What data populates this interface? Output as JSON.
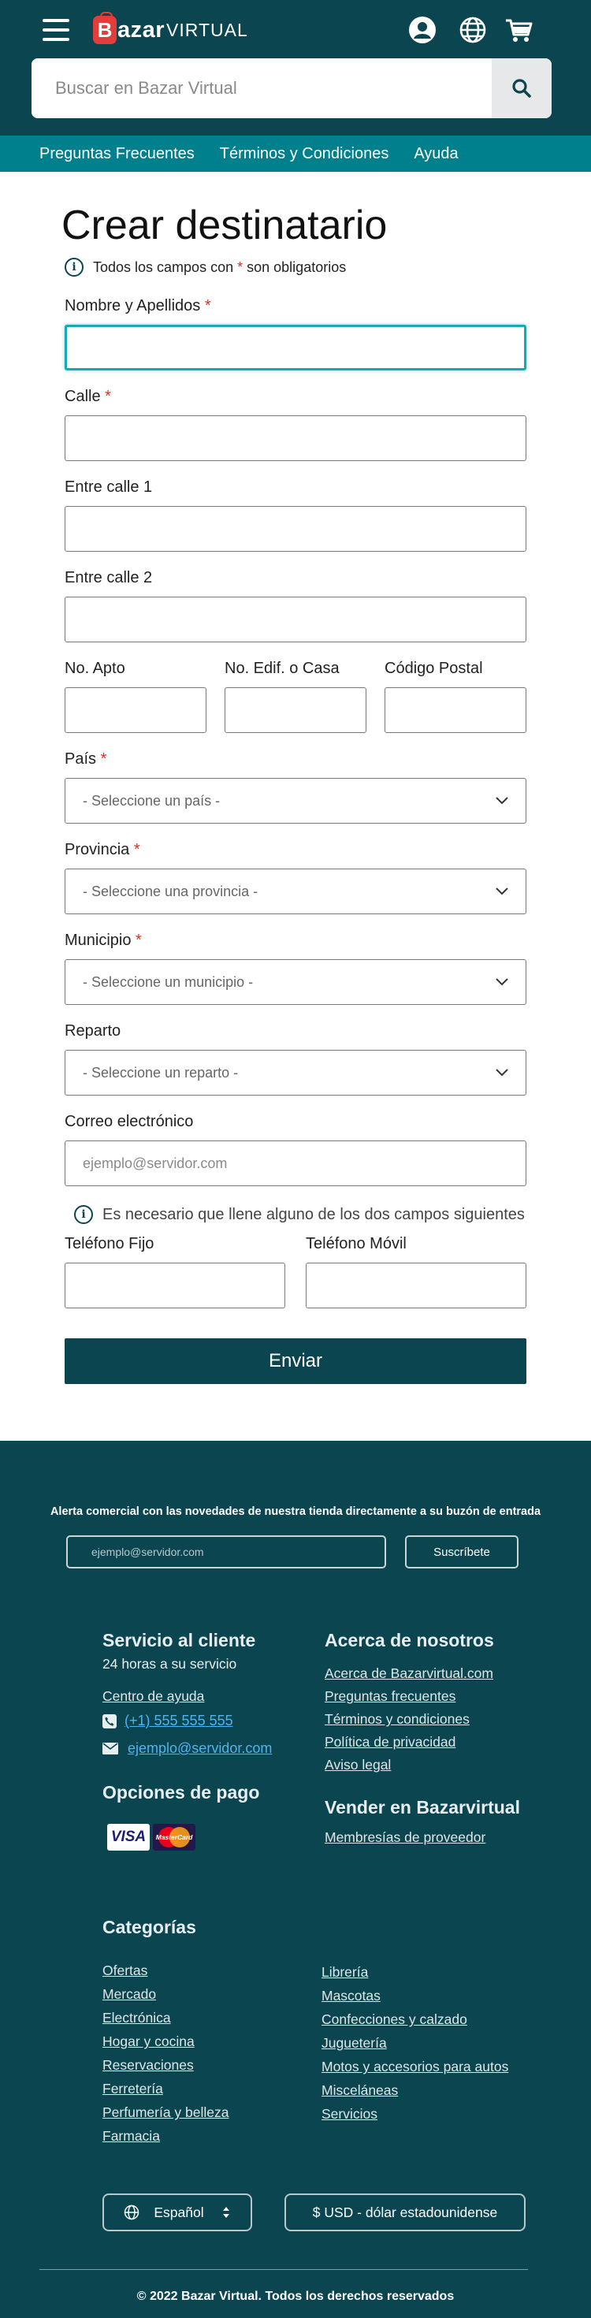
{
  "header": {
    "logo_letter": "B",
    "logo_bazar": "azar",
    "logo_virtual": "VIRTUAL",
    "search_placeholder": "Buscar en Bazar Virtual",
    "icons": [
      "menu-icon",
      "user-icon",
      "globe-icon",
      "cart-icon",
      "search-icon"
    ],
    "subnav": [
      "Preguntas Frecuentes",
      "Términos y Condiciones",
      "Ayuda"
    ]
  },
  "form": {
    "title": "Crear destinatario",
    "required_note_pre": "Todos los campos con",
    "required_star": "*",
    "required_note_post": "son obligatorios",
    "labels": {
      "nombre": "Nombre y Apellidos",
      "calle": "Calle",
      "entre1": "Entre calle 1",
      "entre2": "Entre calle 2",
      "apto": "No. Apto",
      "edif": "No. Edif. o Casa",
      "postal": "Código Postal",
      "pais": "País",
      "provincia": "Provincia",
      "municipio": "Municipio",
      "reparto": "Reparto",
      "correo": "Correo electrónico",
      "tel_fijo": "Teléfono Fijo",
      "tel_movil": "Teléfono Móvil"
    },
    "selects": {
      "pais": "- Seleccione un país -",
      "provincia": "- Seleccione una provincia -",
      "municipio": "- Seleccione un municipio -",
      "reparto": "- Seleccione un reparto -"
    },
    "email_placeholder": "ejemplo@servidor.com",
    "phone_note": "Es necesario que llene alguno de los dos campos siguientes",
    "submit_label": "Enviar"
  },
  "footer": {
    "newsletter_text": "Alerta comercial con las novedades de nuestra tienda directamente a su buzón de entrada",
    "newsletter_placeholder": "ejemplo@servidor.com",
    "newsletter_button": "Suscríbete",
    "service": {
      "title": "Servicio al cliente",
      "hours": "24 horas a su servicio",
      "help": "Centro de ayuda",
      "phone": "(+1) 555 555 555",
      "email": "ejemplo@servidor.com"
    },
    "payment_title": "Opciones de pago",
    "payment_cards": [
      "VISA",
      "MasterCard"
    ],
    "about": {
      "title": "Acerca de nosotros",
      "links": [
        "Acerca de Bazarvirtual.com",
        "Preguntas frecuentes",
        "Términos y condiciones",
        "Política de privacidad",
        "Aviso legal"
      ]
    },
    "sell": {
      "title": "Vender en Bazarvirtual",
      "links": [
        "Membresías de proveedor"
      ]
    },
    "categories": {
      "title": "Categorías",
      "left": [
        "Ofertas",
        "Mercado",
        "Electrónica",
        "Hogar y cocina",
        "Reservaciones",
        "Ferretería",
        "Perfumería y belleza",
        "Farmacia"
      ],
      "right": [
        "Librería",
        "Mascotas",
        "Confecciones y calzado",
        "Juguetería",
        "Motos y accesorios para autos",
        "Misceláneas",
        "Servicios"
      ]
    },
    "language": "Español",
    "currency": "$ USD - dólar estadounidense",
    "copyright": "© 2022  Bazar Virtual. Todos los derechos reservados"
  }
}
